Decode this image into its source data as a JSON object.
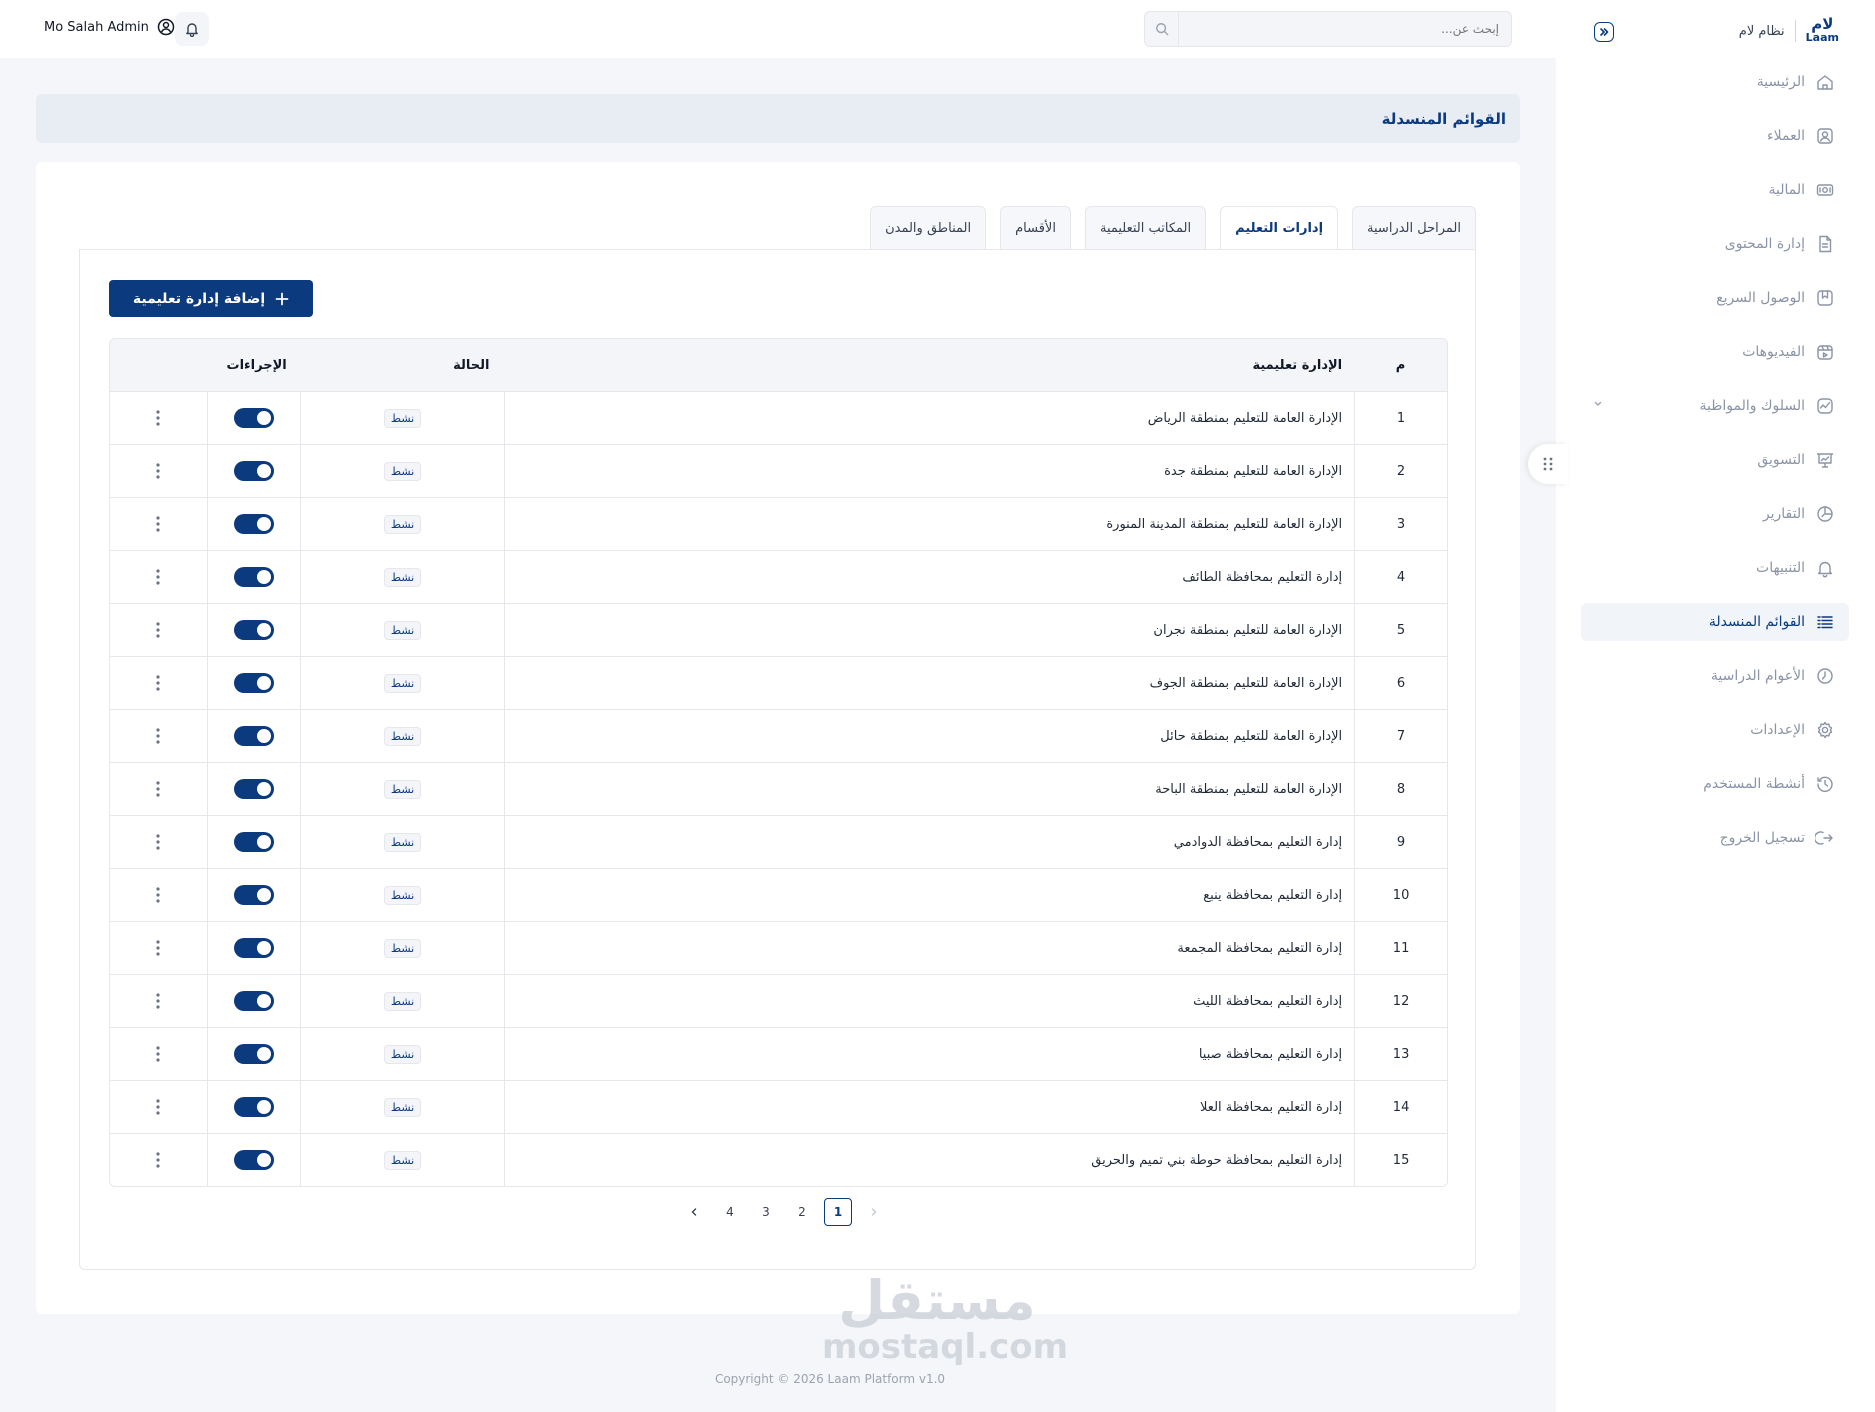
{
  "brand": {
    "logo_ar": "لام",
    "logo_en": "Laam",
    "name": "نظام لام"
  },
  "search": {
    "placeholder": "إبحث عن..."
  },
  "user": {
    "name": "Mo Salah Admin"
  },
  "sidebar": {
    "items": [
      {
        "label": "الرئيسية",
        "icon": "home-icon"
      },
      {
        "label": "العملاء",
        "icon": "user-icon"
      },
      {
        "label": "المالية",
        "icon": "money-icon"
      },
      {
        "label": "إدارة المحتوى",
        "icon": "document-icon"
      },
      {
        "label": "الوصول السريع",
        "icon": "bookmark-icon"
      },
      {
        "label": "الفيديوهات",
        "icon": "video-icon"
      },
      {
        "label": "السلوك والمواظبة",
        "icon": "activity-icon"
      },
      {
        "label": "التسويق",
        "icon": "presentation-icon"
      },
      {
        "label": "التقارير",
        "icon": "reports-icon"
      },
      {
        "label": "التنبيهات",
        "icon": "bell-icon"
      },
      {
        "label": "القوائم المنسدلة",
        "icon": "list-icon",
        "active": true
      },
      {
        "label": "الأعوام الدراسية",
        "icon": "clock-icon"
      },
      {
        "label": "الإعدادات",
        "icon": "gear-icon"
      },
      {
        "label": "أنشطة المستخدم",
        "icon": "history-icon"
      },
      {
        "label": "تسجيل الخروج",
        "icon": "logout-icon"
      }
    ]
  },
  "page": {
    "title": "القوائم المنسدلة"
  },
  "tabs": [
    {
      "label": "المراحل الدراسية"
    },
    {
      "label": "إدارات التعليم",
      "active": true
    },
    {
      "label": "المكاتب التعليمية"
    },
    {
      "label": "الأقسام"
    },
    {
      "label": "المناطق والمدن"
    }
  ],
  "add_button": {
    "label": "إضافة إدارة تعليمية"
  },
  "table": {
    "headers": {
      "num": "م",
      "name": "الإدارة تعليمية",
      "status": "الحالة",
      "actions": "الإجراءات"
    },
    "rows": [
      {
        "num": "1",
        "name": "الإدارة العامة للتعليم بمنطقة الرياض",
        "status": "نشط"
      },
      {
        "num": "2",
        "name": "الإدارة العامة للتعليم بمنطقة جدة",
        "status": "نشط"
      },
      {
        "num": "3",
        "name": "الإدارة العامة للتعليم بمنطقة المدينة المنورة",
        "status": "نشط"
      },
      {
        "num": "4",
        "name": "إدارة التعليم بمحافظة الطائف",
        "status": "نشط"
      },
      {
        "num": "5",
        "name": "الإدارة العامة للتعليم بمنطقة نجران",
        "status": "نشط"
      },
      {
        "num": "6",
        "name": "الإدارة العامة للتعليم بمنطقة الجوف",
        "status": "نشط"
      },
      {
        "num": "7",
        "name": "الإدارة العامة للتعليم بمنطقة حائل",
        "status": "نشط"
      },
      {
        "num": "8",
        "name": "الإدارة العامة للتعليم بمنطقة الباحة",
        "status": "نشط"
      },
      {
        "num": "9",
        "name": "إدارة التعليم بمحافظة الدوادمي",
        "status": "نشط"
      },
      {
        "num": "10",
        "name": "إدارة التعليم بمحافظة ينبع",
        "status": "نشط"
      },
      {
        "num": "11",
        "name": "إدارة التعليم بمحافظة المجمعة",
        "status": "نشط"
      },
      {
        "num": "12",
        "name": "إدارة التعليم بمحافظة الليث",
        "status": "نشط"
      },
      {
        "num": "13",
        "name": "إدارة التعليم بمحافظة صبيا",
        "status": "نشط"
      },
      {
        "num": "14",
        "name": "إدارة التعليم بمحافظة العلا",
        "status": "نشط"
      },
      {
        "num": "15",
        "name": "إدارة التعليم بمحافظة حوطة بني تميم والحريق",
        "status": "نشط"
      }
    ]
  },
  "pagination": {
    "pages": [
      "1",
      "2",
      "3",
      "4"
    ],
    "current": "1"
  },
  "watermark": {
    "ar": "مستقل",
    "en": "mostaql.com"
  },
  "footer": {
    "copyright": "Copyright © 2026 Laam Platform v1.0"
  },
  "colors": {
    "primary": "#0b3a7e",
    "background": "#f4f6fa"
  }
}
